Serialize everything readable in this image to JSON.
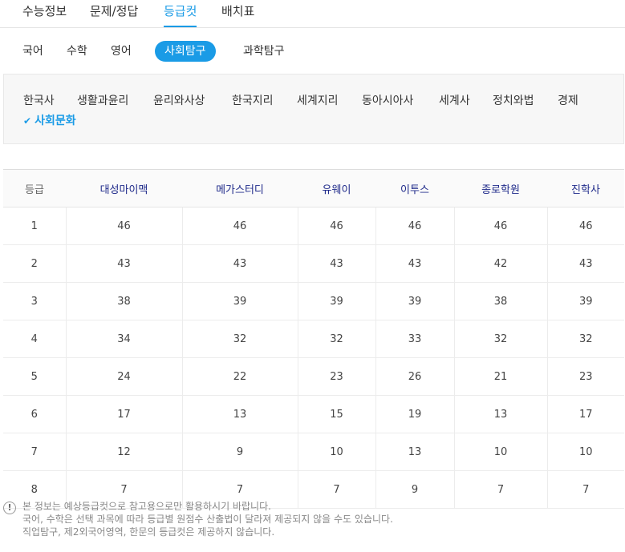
{
  "top_tabs": [
    "수능정보",
    "문제/정답",
    "등급컷",
    "배치표"
  ],
  "subjects": [
    "국어",
    "수학",
    "영어",
    "사회탐구",
    "과학탐구"
  ],
  "sub_subjects": [
    "한국사",
    "생활과윤리",
    "윤리와사상",
    "한국지리",
    "세계지리",
    "동아시아사",
    "세계사",
    "정치와법",
    "경제",
    "사회문화"
  ],
  "active_top_tab": "등급컷",
  "active_subject": "사회탐구",
  "selected_sub_subject": "사회문화",
  "table": {
    "headers": [
      "등급",
      "대성마이맥",
      "메가스터디",
      "유웨이",
      "이투스",
      "종로학원",
      "진학사"
    ],
    "rows": [
      [
        "1",
        "46",
        "46",
        "46",
        "46",
        "46",
        "46"
      ],
      [
        "2",
        "43",
        "43",
        "43",
        "43",
        "42",
        "43"
      ],
      [
        "3",
        "38",
        "39",
        "39",
        "39",
        "38",
        "39"
      ],
      [
        "4",
        "34",
        "32",
        "32",
        "33",
        "32",
        "32"
      ],
      [
        "5",
        "24",
        "22",
        "23",
        "26",
        "21",
        "23"
      ],
      [
        "6",
        "17",
        "13",
        "15",
        "19",
        "13",
        "17"
      ],
      [
        "7",
        "12",
        "9",
        "10",
        "13",
        "10",
        "10"
      ],
      [
        "8",
        "7",
        "7",
        "7",
        "9",
        "7",
        "7"
      ]
    ]
  },
  "notes": [
    "본 정보는 예상등급컷으로 참고용으로만 활용하시기 바랍니다.",
    "국어, 수학은 선택 과목에 따라 등급별 원점수 산출법이 달라져 제공되지 않을 수도 있습니다.",
    "직업탐구, 제2외국어영역, 한문의 등급컷은 제공하지 않습니다."
  ],
  "colors": {
    "accent": "#1a9be6",
    "header_text": "#1f2a8a"
  }
}
